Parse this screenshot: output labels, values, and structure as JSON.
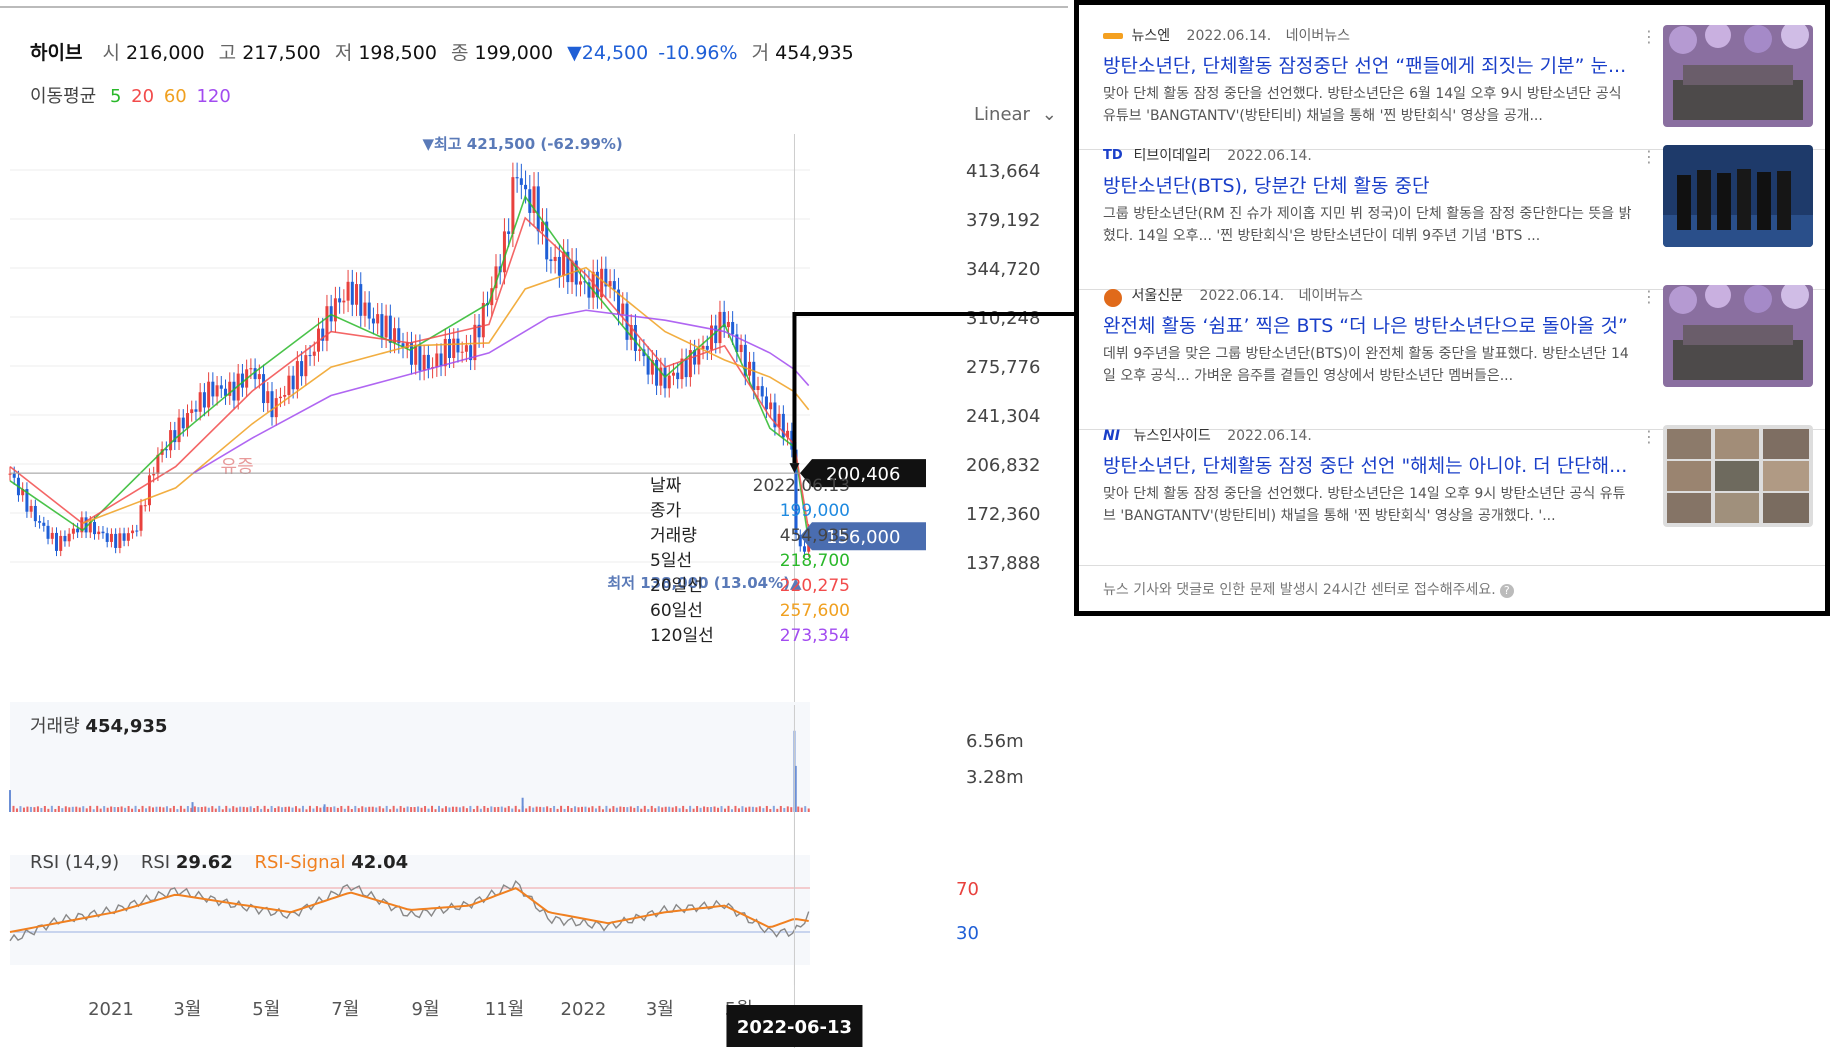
{
  "header": {
    "name": "하이브",
    "open_label": "시",
    "open": "216,000",
    "high_label": "고",
    "high": "217,500",
    "low_label": "저",
    "low": "198,500",
    "close_label": "종",
    "close": "199,000",
    "change": "▼24,500",
    "change_pct": "-10.96%",
    "volume_label": "거",
    "volume": "454,935"
  },
  "ma_line": {
    "label": "이동평균",
    "periods": [
      "5",
      "20",
      "60",
      "120"
    ],
    "colors": [
      "#2ab82a",
      "#f24b4b",
      "#f0a020",
      "#a24bf0"
    ]
  },
  "scale_mode": "Linear",
  "chart_data": [
    {
      "type": "line",
      "subtype": "candlestick-with-moving-averages",
      "y_ticks": [
        "413,664",
        "379,192",
        "344,720",
        "310,248",
        "275,776",
        "241,304",
        "206,832",
        "172,360",
        "137,888"
      ],
      "y_tick_values": [
        413664,
        379192,
        344720,
        310248,
        275776,
        241304,
        206832,
        172360,
        137888
      ],
      "ylim": [
        128000,
        432000
      ],
      "x_ticks": [
        "2021",
        "3월",
        "5월",
        "7월",
        "9월",
        "11월",
        "2022",
        "3월",
        "5월"
      ],
      "x_tick_dates": [
        "2021-01-01",
        "2021-03-01",
        "2021-05-01",
        "2021-07-01",
        "2021-09-01",
        "2021-11-01",
        "2022-01-01",
        "2022-03-01",
        "2022-05-01"
      ],
      "xlim": [
        "2020-10-15",
        "2022-06-25"
      ],
      "close_series": {
        "dates": [
          "2020-10-15",
          "2020-11-01",
          "2020-11-20",
          "2020-12-10",
          "2021-01-04",
          "2021-01-20",
          "2021-02-05",
          "2021-02-20",
          "2021-03-05",
          "2021-03-20",
          "2021-04-05",
          "2021-04-20",
          "2021-05-05",
          "2021-05-20",
          "2021-06-05",
          "2021-06-20",
          "2021-07-05",
          "2021-07-20",
          "2021-08-05",
          "2021-08-20",
          "2021-09-05",
          "2021-09-20",
          "2021-10-05",
          "2021-10-20",
          "2021-11-01",
          "2021-11-10",
          "2021-11-17",
          "2021-11-25",
          "2021-12-05",
          "2021-12-20",
          "2022-01-03",
          "2022-01-20",
          "2022-02-05",
          "2022-02-20",
          "2022-03-05",
          "2022-03-20",
          "2022-04-05",
          "2022-04-20",
          "2022-05-02",
          "2022-05-15",
          "2022-05-25",
          "2022-06-05",
          "2022-06-10",
          "2022-06-13",
          "2022-06-14",
          "2022-06-17",
          "2022-06-20",
          "2022-06-24"
        ],
        "values": [
          200000,
          172000,
          150000,
          165000,
          152000,
          160000,
          210000,
          230000,
          245000,
          260000,
          258000,
          275000,
          245000,
          265000,
          285000,
          315000,
          330000,
          310000,
          300000,
          285000,
          275000,
          290000,
          285000,
          325000,
          360000,
          415000,
          395000,
          390000,
          350000,
          345000,
          330000,
          338000,
          300000,
          275000,
          265000,
          275000,
          290000,
          310000,
          285000,
          260000,
          245000,
          230000,
          225000,
          199000,
          160000,
          145000,
          148000,
          156000
        ]
      },
      "moving_averages": [
        {
          "name": "5일선",
          "dates": [
            "2020-10-15",
            "2020-12-10",
            "2021-02-20",
            "2021-04-20",
            "2021-06-20",
            "2021-08-20",
            "2021-10-20",
            "2021-11-17",
            "2022-01-03",
            "2022-03-05",
            "2022-04-20",
            "2022-05-25",
            "2022-06-13",
            "2022-06-24"
          ],
          "values": [
            195000,
            160000,
            225000,
            270000,
            312000,
            287000,
            320000,
            395000,
            335000,
            268000,
            305000,
            232000,
            218700,
            152000
          ]
        },
        {
          "name": "20일선",
          "dates": [
            "2020-10-15",
            "2020-12-10",
            "2021-02-20",
            "2021-04-20",
            "2021-06-20",
            "2021-08-20",
            "2021-10-20",
            "2021-11-17",
            "2022-01-03",
            "2022-03-05",
            "2022-04-20",
            "2022-05-25",
            "2022-06-13",
            "2022-06-24"
          ],
          "values": [
            205000,
            165000,
            205000,
            258000,
            300000,
            292000,
            305000,
            380000,
            340000,
            275000,
            290000,
            240000,
            220275,
            160000
          ]
        },
        {
          "name": "60일선",
          "dates": [
            "2020-12-10",
            "2021-02-20",
            "2021-04-20",
            "2021-06-20",
            "2021-08-20",
            "2021-10-20",
            "2021-11-17",
            "2022-01-03",
            "2022-03-05",
            "2022-04-20",
            "2022-05-25",
            "2022-06-13",
            "2022-06-24"
          ],
          "values": [
            165000,
            190000,
            235000,
            275000,
            290000,
            292000,
            330000,
            345000,
            300000,
            280000,
            268000,
            257600,
            245000
          ]
        },
        {
          "name": "120일선",
          "dates": [
            "2021-03-05",
            "2021-04-20",
            "2021-06-20",
            "2021-08-20",
            "2021-10-20",
            "2021-12-05",
            "2022-01-03",
            "2022-03-05",
            "2022-04-20",
            "2022-05-25",
            "2022-06-13",
            "2022-06-24"
          ],
          "values": [
            200000,
            225000,
            255000,
            270000,
            285000,
            310000,
            315000,
            308000,
            300000,
            285000,
            273354,
            262000
          ]
        }
      ],
      "annotations": {
        "high": "▼최고 421,500 (-62.99%)",
        "high_value": 421500,
        "high_date": "2021-11-15",
        "low": "최저 138,000 (13.04%)▲",
        "low_value": 138000,
        "low_date": "2022-06-20",
        "event": "유증",
        "event_date": "2021-03-05",
        "current_price_tag": "200,406",
        "current_price_value": 200406,
        "close_tag": "156,000",
        "close_tag_value": 156000,
        "crosshair_date": "2022-06-13"
      },
      "tooltip": {
        "rows": [
          {
            "label": "날짜",
            "value": "2022.06.13"
          },
          {
            "label": "종가",
            "value": "199,000"
          },
          {
            "label": "거래량",
            "value": "454,935"
          },
          {
            "label": "5일선",
            "value": "218,700"
          },
          {
            "label": "20일선",
            "value": "220,275"
          },
          {
            "label": "60일선",
            "value": "257,600"
          },
          {
            "label": "120일선",
            "value": "273,354"
          }
        ]
      }
    },
    {
      "type": "bar",
      "title": "거래량",
      "title_value": "454,935",
      "y_ticks": [
        "6.56m",
        "3.28m"
      ],
      "y_tick_values": [
        6560000,
        3280000
      ],
      "ylim": [
        0,
        8200000
      ],
      "spikes": {
        "dates": [
          "2020-10-15",
          "2021-03-05",
          "2021-06-15",
          "2021-11-15",
          "2022-06-13",
          "2022-06-14"
        ],
        "values": [
          2000000,
          900000,
          700000,
          1300000,
          7400000,
          4200000
        ]
      },
      "baseline_volume": 400000
    },
    {
      "type": "line",
      "title": "RSI (14,9)",
      "rsi_label": "RSI",
      "rsi_value": "29.62",
      "signal_label": "RSI-Signal",
      "signal_value": "42.04",
      "y_ticks": [
        "70",
        "30"
      ],
      "y_tick_values": [
        70,
        30
      ],
      "ylim": [
        0,
        100
      ],
      "rsi": {
        "dates": [
          "2020-10-15",
          "2020-11-20",
          "2021-01-04",
          "2021-02-20",
          "2021-04-05",
          "2021-05-20",
          "2021-07-05",
          "2021-08-20",
          "2021-10-05",
          "2021-11-10",
          "2021-12-05",
          "2022-01-20",
          "2022-03-05",
          "2022-04-20",
          "2022-05-25",
          "2022-06-13",
          "2022-06-24"
        ],
        "values": [
          22,
          40,
          50,
          68,
          55,
          45,
          72,
          45,
          55,
          74,
          42,
          35,
          50,
          55,
          30,
          29.62,
          45
        ]
      },
      "signal": {
        "dates": [
          "2020-10-15",
          "2020-11-20",
          "2021-01-04",
          "2021-02-20",
          "2021-04-05",
          "2021-05-20",
          "2021-07-05",
          "2021-08-20",
          "2021-10-05",
          "2021-11-10",
          "2021-12-05",
          "2022-01-20",
          "2022-03-05",
          "2022-04-20",
          "2022-05-25",
          "2022-06-13",
          "2022-06-24"
        ],
        "values": [
          30,
          38,
          48,
          64,
          56,
          48,
          66,
          50,
          54,
          70,
          48,
          38,
          48,
          54,
          34,
          42.04,
          40
        ]
      }
    }
  ],
  "crosshair_date_label": "2022-06-13",
  "news": {
    "items": [
      {
        "source": "뉴스엔",
        "date": "2022.06.14.",
        "platform": "네이버뉴스",
        "title": "방탄소년단, 단체활동 잠정중단 선언 “팬들에게 죄짓는 기분” 눈...",
        "body": "맞아 단체 활동 잠정 중단을 선언했다. 방탄소년단은 6월 14일 오후 9시 방탄소년단 공식 유튜브 'BANGTANTV'(방탄티비) 채널을 통해 '찐 방탄회식' 영상을 공개...",
        "thumb": "balloons",
        "logo": "newsen-logo-icon"
      },
      {
        "source": "티브이데일리",
        "date": "2022.06.14.",
        "platform": "",
        "title": "방탄소년단(BTS), 당분간 단체 활동 중단",
        "body": "그룹 방탄소년단(RM 진 슈가 제이홉 지민 뷔 정국)이 단체 활동을 잠정 중단한다는 뜻을 밝혔다. 14일 오후... '찐 방탄회식'은 방탄소년단이 데뷔 9주년 기념 'BTS ...",
        "thumb": "group",
        "logo": "td-logo-icon"
      },
      {
        "source": "서울신문",
        "date": "2022.06.14.",
        "platform": "네이버뉴스",
        "title": "완전체 활동 ‘쉼표’ 찍은 BTS “더 나은 방탄소년단으로 돌아올 것”",
        "body": "데뷔 9주년을 맞은 그룹 방탄소년단(BTS)이 완전체 활동 중단을 발표했다. 방탄소년단 14일 오후 공식... 가벼운 음주를 곁들인 영상에서 방탄소년단 멤버들은...",
        "thumb": "balloons",
        "logo": "seoul-logo-icon"
      },
      {
        "source": "뉴스인사이드",
        "date": "2022.06.14.",
        "platform": "",
        "title": "방탄소년단, 단체활동 잠정 중단 선언 \"해체는 아니야. 더 단단해...",
        "body": "맞아 단체 활동 잠정 중단을 선언했다. 방탄소년단은 14일 오후 9시 방탄소년단 공식 유튜브 'BANGTANTV'(방탄티비) 채널을 통해 '찐 방탄회식' 영상을 공개했다. '...",
        "thumb": "grid",
        "logo": "ni-logo-icon"
      }
    ],
    "footer": "뉴스 기사와 댓글로 인한 문제 발생시 24시간 센터로 접수해주세요."
  },
  "colors": {
    "up": "#e8413d",
    "down": "#1f5fd6",
    "ma5": "#2ab82a",
    "ma20": "#f24b4b",
    "ma60": "#f0a020",
    "ma120": "#a24bf0",
    "link": "#1a3fc9"
  }
}
